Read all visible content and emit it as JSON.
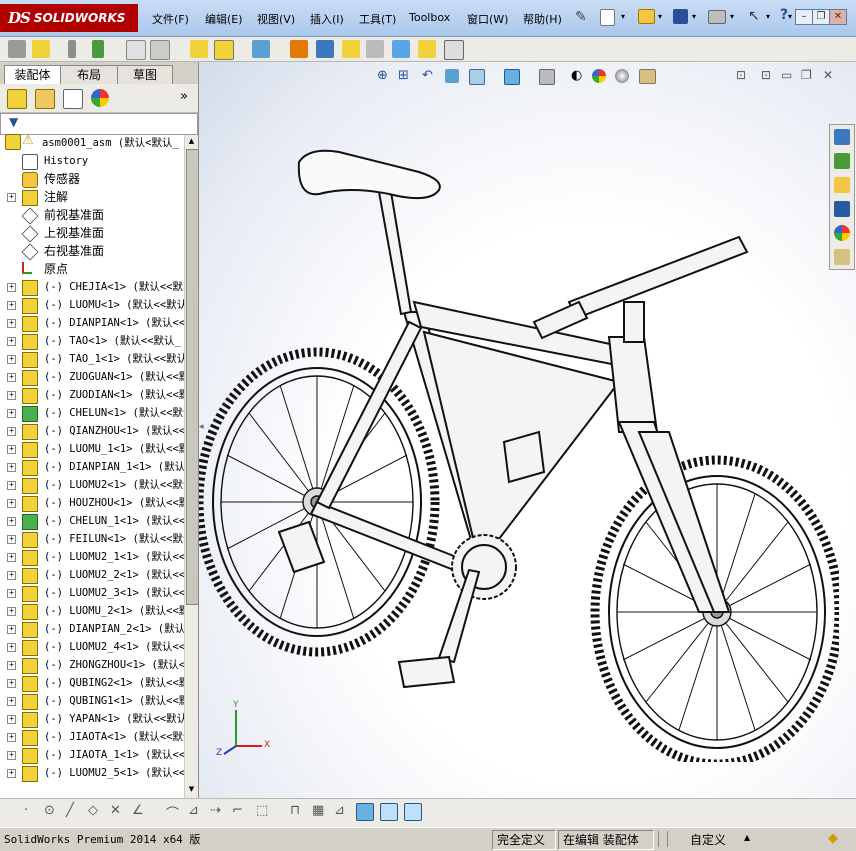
{
  "app": {
    "logo_ds": "DS",
    "logo_name": "SOLIDWORKS"
  },
  "menu": [
    "文件(F)",
    "编辑(E)",
    "视图(V)",
    "插入(I)",
    "工具(T)",
    "Toolbox",
    "窗口(W)",
    "帮助(H)"
  ],
  "tabs": [
    "装配体",
    "布局",
    "草图"
  ],
  "tree": {
    "root": "asm0001_asm  (默认<默认_",
    "items": [
      {
        "label": "History",
        "icon": "history-icon",
        "expand": false,
        "font": "mono"
      },
      {
        "label": "传感器",
        "icon": "sensor-icon",
        "expand": false,
        "font": "cn"
      },
      {
        "label": "注解",
        "icon": "annotation-icon",
        "expand": true,
        "font": "cn"
      },
      {
        "label": "前视基准面",
        "icon": "plane-icon",
        "expand": false,
        "font": "cn"
      },
      {
        "label": "上视基准面",
        "icon": "plane-icon",
        "expand": false,
        "font": "cn"
      },
      {
        "label": "右视基准面",
        "icon": "plane-icon",
        "expand": false,
        "font": "cn"
      },
      {
        "label": "原点",
        "icon": "origin-icon",
        "expand": false,
        "font": "cn"
      },
      {
        "label": "(-) CHEJIA<1> (默认<<默",
        "icon": "part-icon",
        "expand": true,
        "font": "mono"
      },
      {
        "label": "(-) LUOMU<1> (默认<<默认",
        "icon": "part-icon",
        "expand": true,
        "font": "mono"
      },
      {
        "label": "(-) DIANPIAN<1> (默认<<",
        "icon": "part-icon",
        "expand": true,
        "font": "mono"
      },
      {
        "label": "(-) TAO<1> (默认<<默认_",
        "icon": "part-icon",
        "expand": true,
        "font": "mono"
      },
      {
        "label": "(-) TAO_1<1> (默认<<默认",
        "icon": "part-icon",
        "expand": true,
        "font": "mono"
      },
      {
        "label": "(-) ZUOGUAN<1> (默认<<默",
        "icon": "part-icon",
        "expand": true,
        "font": "mono"
      },
      {
        "label": "(-) ZUODIAN<1> (默认<<默",
        "icon": "part-icon",
        "expand": true,
        "font": "mono"
      },
      {
        "label": "(-) CHELUN<1> (默认<<默认",
        "icon": "subasm-icon",
        "expand": true,
        "font": "mono"
      },
      {
        "label": "(-) QIANZHOU<1> (默认<<默",
        "icon": "part-icon",
        "expand": true,
        "font": "mono"
      },
      {
        "label": "(-) LUOMU_1<1> (默认<<默",
        "icon": "part-icon",
        "expand": true,
        "font": "mono"
      },
      {
        "label": "(-) DIANPIAN_1<1> (默认",
        "icon": "part-icon",
        "expand": true,
        "font": "mono"
      },
      {
        "label": "(-) LUOMU2<1> (默认<<默认",
        "icon": "part-icon",
        "expand": true,
        "font": "mono"
      },
      {
        "label": "(-) HOUZHOU<1> (默认<<默",
        "icon": "part-icon",
        "expand": true,
        "font": "mono"
      },
      {
        "label": "(-) CHELUN_1<1> (默认<<",
        "icon": "subasm-icon",
        "expand": true,
        "font": "mono"
      },
      {
        "label": "(-) FEILUN<1> (默认<<默认",
        "icon": "part-icon",
        "expand": true,
        "font": "mono"
      },
      {
        "label": "(-) LUOMU2_1<1> (默认<<",
        "icon": "part-icon",
        "expand": true,
        "font": "mono"
      },
      {
        "label": "(-) LUOMU2_2<1> (默认<<",
        "icon": "part-icon",
        "expand": true,
        "font": "mono"
      },
      {
        "label": "(-) LUOMU2_3<1> (默认<<",
        "icon": "part-icon",
        "expand": true,
        "font": "mono"
      },
      {
        "label": "(-) LUOMU_2<1> (默认<<默",
        "icon": "part-icon",
        "expand": true,
        "font": "mono"
      },
      {
        "label": "(-) DIANPIAN_2<1> (默认",
        "icon": "part-icon",
        "expand": true,
        "font": "mono"
      },
      {
        "label": "(-) LUOMU2_4<1> (默认<<",
        "icon": "part-icon",
        "expand": true,
        "font": "mono"
      },
      {
        "label": "(-) ZHONGZHOU<1> (默认<",
        "icon": "part-icon",
        "expand": true,
        "font": "mono"
      },
      {
        "label": "(-) QUBING2<1> (默认<<默",
        "icon": "part-icon",
        "expand": true,
        "font": "mono"
      },
      {
        "label": "(-) QUBING1<1> (默认<<默",
        "icon": "part-icon",
        "expand": true,
        "font": "mono"
      },
      {
        "label": "(-) YAPAN<1> (默认<<默认",
        "icon": "part-icon",
        "expand": true,
        "font": "mono"
      },
      {
        "label": "(-) JIAOTA<1> (默认<<默认",
        "icon": "part-icon",
        "expand": true,
        "font": "mono"
      },
      {
        "label": "(-) JIAOTA_1<1> (默认<<",
        "icon": "part-icon",
        "expand": true,
        "font": "mono"
      },
      {
        "label": "(-) LUOMU2_5<1> (默认<<",
        "icon": "part-icon",
        "expand": true,
        "font": "mono"
      }
    ]
  },
  "triad": {
    "x": "X",
    "y": "Y",
    "z": "Z"
  },
  "status": {
    "product": "SolidWorks Premium 2014 x64 版",
    "defined": "完全定义",
    "editing": "在编辑 装配体",
    "units": "自定义",
    "units_arrow": "▲"
  },
  "colors": {
    "accent": "#b00000",
    "part": "#f2d23a",
    "subasm": "#4caf50"
  }
}
